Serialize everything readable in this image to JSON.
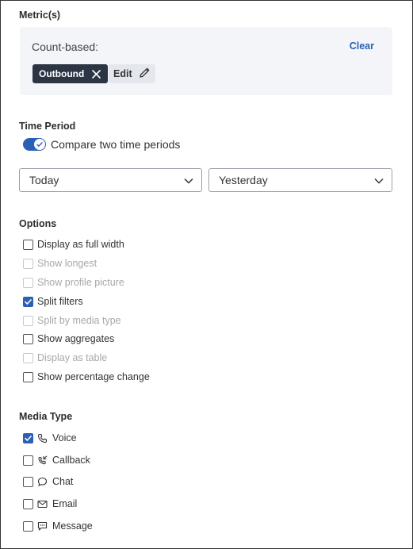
{
  "metrics": {
    "title": "Metric(s)",
    "group_label": "Count-based:",
    "clear_label": "Clear",
    "chip_label": "Outbound",
    "edit_label": "Edit"
  },
  "time_period": {
    "title": "Time Period",
    "toggle_label": "Compare two time periods",
    "toggle_on": true,
    "select1": "Today",
    "select2": "Yesterday"
  },
  "options": {
    "title": "Options",
    "items": [
      {
        "label": "Display as full width",
        "checked": false,
        "disabled": false
      },
      {
        "label": "Show longest",
        "checked": false,
        "disabled": true
      },
      {
        "label": "Show profile picture",
        "checked": false,
        "disabled": true
      },
      {
        "label": "Split filters",
        "checked": true,
        "disabled": false
      },
      {
        "label": "Split by media type",
        "checked": false,
        "disabled": true
      },
      {
        "label": "Show aggregates",
        "checked": false,
        "disabled": false
      },
      {
        "label": "Display as table",
        "checked": false,
        "disabled": true
      },
      {
        "label": "Show percentage change",
        "checked": false,
        "disabled": false
      }
    ]
  },
  "media_type": {
    "title": "Media Type",
    "items": [
      {
        "label": "Voice",
        "icon": "phone-icon",
        "checked": true
      },
      {
        "label": "Callback",
        "icon": "callback-icon",
        "checked": false
      },
      {
        "label": "Chat",
        "icon": "chat-bubble-icon",
        "checked": false
      },
      {
        "label": "Email",
        "icon": "envelope-icon",
        "checked": false
      },
      {
        "label": "Message",
        "icon": "message-icon",
        "checked": false
      }
    ]
  },
  "colors": {
    "accent": "#2a60b5",
    "chip_bg": "#2b3544",
    "panel_bg": "#f3f5f8"
  }
}
